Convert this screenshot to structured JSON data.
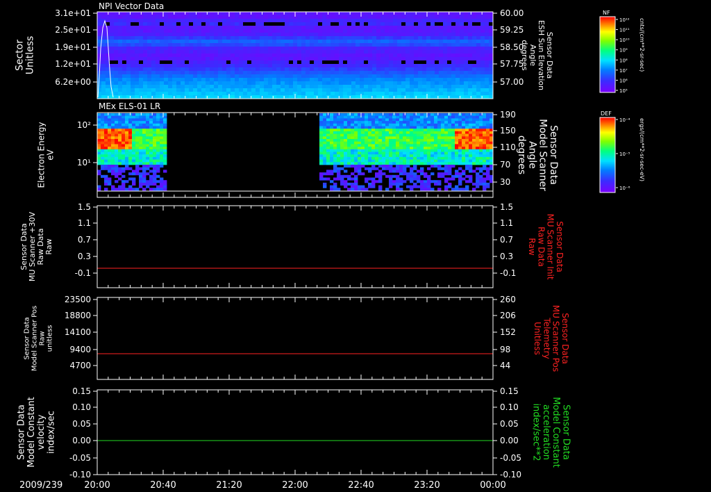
{
  "date_label": "2009/239",
  "time_ticks": [
    "20:00",
    "20:40",
    "21:20",
    "22:00",
    "22:40",
    "23:20",
    "00:00"
  ],
  "colors": {
    "white": "#ffffff",
    "red": "#ff2222",
    "green": "#22dd22",
    "black": "#000000"
  },
  "panels": [
    {
      "id": "p1",
      "title": "NPI Vector Data",
      "left_label": [
        "Sector",
        "Unitless"
      ],
      "right_label": [
        "Sensor Data",
        "ESH Sun Elevation",
        "Angle",
        "degrees"
      ],
      "left_ticks": [
        "3.1e+01",
        "2.5e+01",
        "1.9e+01",
        "1.2e+01",
        "6.2e+00"
      ],
      "right_ticks": [
        "60.00",
        "59.25",
        "58.50",
        "57.75",
        "57.00"
      ]
    },
    {
      "id": "p2",
      "title": "MEx ELS-01 LR",
      "left_label": [
        "Electron Energy",
        "eV"
      ],
      "right_label": [
        "Sensor Data",
        "Model Scanner",
        "Angle",
        "degrees"
      ],
      "left_ticks": [
        "10²",
        "10¹"
      ],
      "right_ticks": [
        "190",
        "150",
        "110",
        "70",
        "30"
      ]
    },
    {
      "id": "p3",
      "left_label": [
        "Sensor Data",
        "MU Scanner +30V",
        "Raw Data",
        "Raw"
      ],
      "right_label": [
        "Sensor Data",
        "MU Scanner Init",
        "Raw Data",
        "Raw"
      ],
      "left_ticks": [
        "1.5",
        "1.1",
        "0.7",
        "0.3",
        "-0.1"
      ],
      "right_ticks": [
        "1.5",
        "1.1",
        "0.7",
        "0.3",
        "-0.1"
      ]
    },
    {
      "id": "p4",
      "left_label": [
        "Sensor Data",
        "Model Scanner Pos",
        "Raw",
        "unitless"
      ],
      "right_label": [
        "Sensor Data",
        "MU Scanner Pos",
        "Telemetry",
        "Unitless"
      ],
      "left_ticks": [
        "23500",
        "18800",
        "14100",
        "9400",
        "4700"
      ],
      "right_ticks": [
        "260",
        "206",
        "152",
        "98",
        "44"
      ]
    },
    {
      "id": "p5",
      "left_label": [
        "Sensor Data",
        "Model Constant",
        "velocity",
        "index/sec"
      ],
      "right_label": [
        "Sensor Data",
        "Model Constant",
        "acceleration",
        "index/sec**2"
      ],
      "left_ticks": [
        "0.15",
        "0.10",
        "0.05",
        "0.00",
        "-0.05",
        "-0.10"
      ],
      "right_ticks": [
        "0.15",
        "0.10",
        "0.05",
        "0.00",
        "-0.05",
        "-0.10"
      ]
    }
  ],
  "colorbars": [
    {
      "id": "cb1",
      "label": "NF",
      "unit": "cnts/(cm**2-sr-sec)",
      "ticks": [
        "10¹²",
        "10¹¹",
        "10¹⁰",
        "10⁹",
        "10⁸",
        "10⁷",
        "10⁶",
        "10⁵"
      ]
    },
    {
      "id": "cb2",
      "label": "DEF",
      "unit": "ergs/(cm**2-sr-sec-eV)",
      "ticks": [
        "10⁻⁴",
        "10⁻⁵",
        "10⁻⁶"
      ]
    }
  ],
  "chart_data": [
    {
      "type": "heatmap",
      "title": "NPI Vector Data",
      "x_range": [
        "20:00",
        "00:00"
      ],
      "ylabel": "Sector Unitless",
      "ylim": [
        0,
        31
      ],
      "color_scale": "log",
      "colorbar_label": "NF"
    },
    {
      "type": "heatmap",
      "title": "MEx ELS-01 LR",
      "x_range": [
        "20:00",
        "00:00"
      ],
      "ylabel": "Electron Energy eV",
      "yscale": "log",
      "ylim": [
        1,
        200
      ],
      "data_gap": [
        "20:40",
        "22:10"
      ],
      "color_scale": "log",
      "colorbar_label": "DEF"
    },
    {
      "type": "line",
      "ylabel": "Sensor Data MU Scanner +30V Raw Data Raw",
      "ylim": [
        -0.3,
        1.5
      ],
      "series": [
        {
          "name": "Sensor Data MU Scanner Init Raw Data Raw",
          "values": [
            0,
            0
          ],
          "color": "#ff2222"
        }
      ],
      "x": [
        "20:00",
        "00:00"
      ]
    },
    {
      "type": "line",
      "ylabel": "Sensor Data Model Scanner Pos Raw unitless",
      "ylim": [
        0,
        23500
      ],
      "series": [
        {
          "name": "Sensor Data MU Scanner Pos Telemetry Unitless",
          "values": [
            8000,
            8000
          ],
          "color": "#ff2222"
        }
      ],
      "x": [
        "20:00",
        "00:00"
      ]
    },
    {
      "type": "line",
      "ylabel": "Sensor Data Model Constant velocity index/sec",
      "ylim": [
        -0.1,
        0.15
      ],
      "series": [
        {
          "name": "Sensor Data Model Constant acceleration index/sec**2",
          "values": [
            0,
            0
          ],
          "color": "#22dd22"
        }
      ],
      "x": [
        "20:00",
        "00:00"
      ]
    }
  ]
}
